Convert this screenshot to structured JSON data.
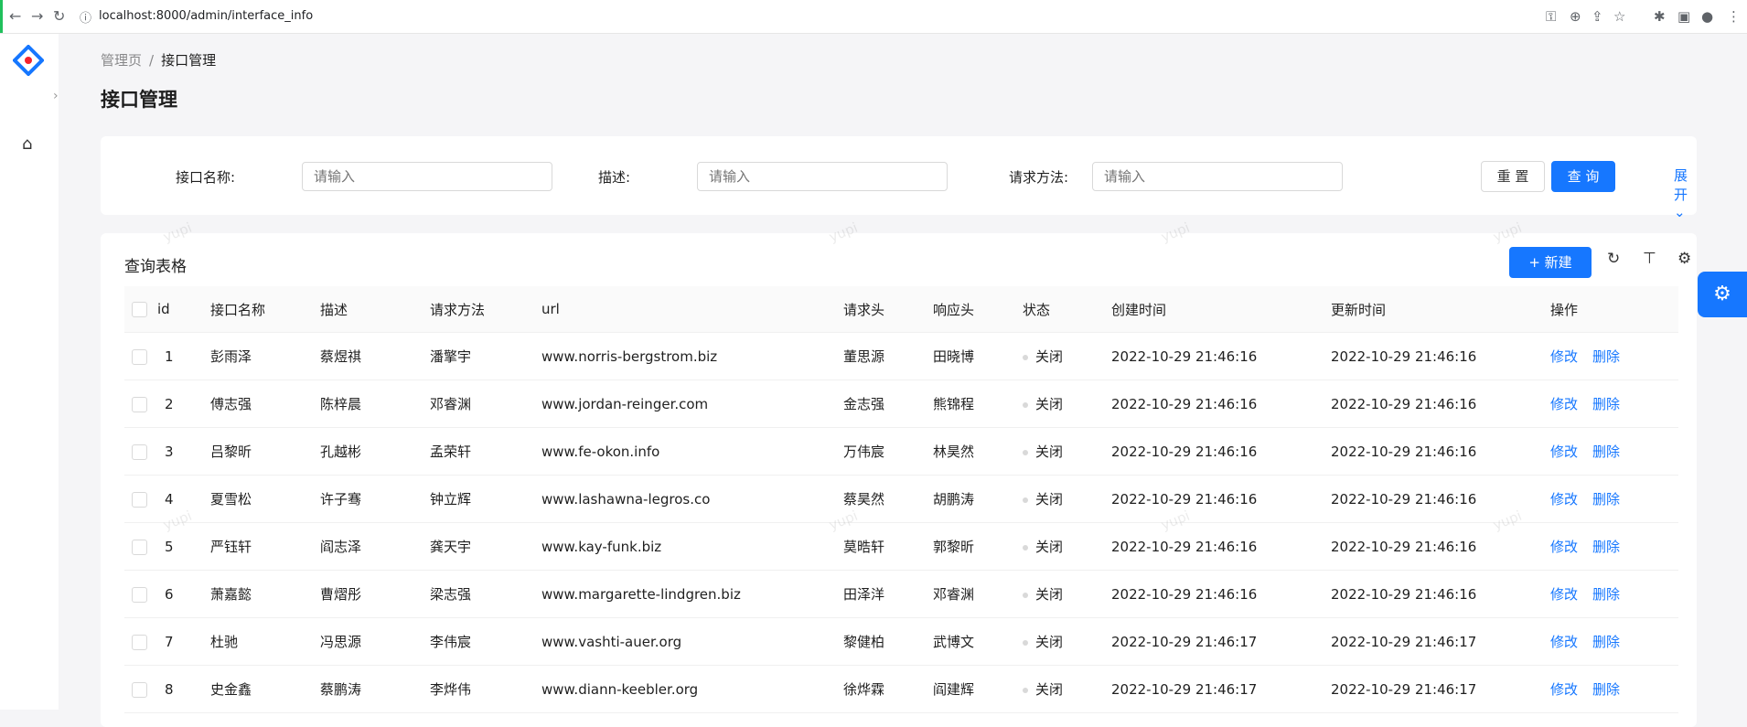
{
  "browser": {
    "url": "localhost:8000/admin/interface_info"
  },
  "breadcrumb": {
    "parent": "管理页",
    "separator": "/",
    "current": "接口管理"
  },
  "page_title": "接口管理",
  "search": {
    "fields": [
      {
        "label": "接口名称:",
        "placeholder": "请输入"
      },
      {
        "label": "描述:",
        "placeholder": "请输入"
      },
      {
        "label": "请求方法:",
        "placeholder": "请输入"
      }
    ],
    "reset_label": "重 置",
    "query_label": "查 询",
    "expand_label": "展开"
  },
  "table": {
    "title": "查询表格",
    "new_label": "+ 新建",
    "columns": [
      "id",
      "接口名称",
      "描述",
      "请求方法",
      "url",
      "请求头",
      "响应头",
      "状态",
      "创建时间",
      "更新时间",
      "操作"
    ],
    "edit_label": "修改",
    "delete_label": "删除",
    "rows": [
      {
        "id": "1",
        "name": "彭雨泽",
        "desc": "蔡煜祺",
        "method": "潘擎宇",
        "url": "www.norris-bergstrom.biz",
        "req": "董思源",
        "resp": "田晓博",
        "status": "关闭",
        "created": "2022-10-29 21:46:16",
        "updated": "2022-10-29 21:46:16"
      },
      {
        "id": "2",
        "name": "傅志强",
        "desc": "陈梓晨",
        "method": "邓睿渊",
        "url": "www.jordan-reinger.com",
        "req": "金志强",
        "resp": "熊锦程",
        "status": "关闭",
        "created": "2022-10-29 21:46:16",
        "updated": "2022-10-29 21:46:16"
      },
      {
        "id": "3",
        "name": "吕黎昕",
        "desc": "孔越彬",
        "method": "孟荣轩",
        "url": "www.fe-okon.info",
        "req": "万伟宸",
        "resp": "林昊然",
        "status": "关闭",
        "created": "2022-10-29 21:46:16",
        "updated": "2022-10-29 21:46:16"
      },
      {
        "id": "4",
        "name": "夏雪松",
        "desc": "许子骞",
        "method": "钟立辉",
        "url": "www.lashawna-legros.co",
        "req": "蔡昊然",
        "resp": "胡鹏涛",
        "status": "关闭",
        "created": "2022-10-29 21:46:16",
        "updated": "2022-10-29 21:46:16"
      },
      {
        "id": "5",
        "name": "严钰轩",
        "desc": "阎志泽",
        "method": "龚天宇",
        "url": "www.kay-funk.biz",
        "req": "莫晧轩",
        "resp": "郭黎昕",
        "status": "关闭",
        "created": "2022-10-29 21:46:16",
        "updated": "2022-10-29 21:46:16"
      },
      {
        "id": "6",
        "name": "萧嘉懿",
        "desc": "曹熠彤",
        "method": "梁志强",
        "url": "www.margarette-lindgren.biz",
        "req": "田泽洋",
        "resp": "邓睿渊",
        "status": "关闭",
        "created": "2022-10-29 21:46:16",
        "updated": "2022-10-29 21:46:16"
      },
      {
        "id": "7",
        "name": "杜驰",
        "desc": "冯思源",
        "method": "李伟宸",
        "url": "www.vashti-auer.org",
        "req": "黎健柏",
        "resp": "武博文",
        "status": "关闭",
        "created": "2022-10-29 21:46:17",
        "updated": "2022-10-29 21:46:17"
      },
      {
        "id": "8",
        "name": "史金鑫",
        "desc": "蔡鹏涛",
        "method": "李烨伟",
        "url": "www.diann-keebler.org",
        "req": "徐烨霖",
        "resp": "阎建辉",
        "status": "关闭",
        "created": "2022-10-29 21:46:17",
        "updated": "2022-10-29 21:46:17"
      }
    ]
  },
  "watermark": "yupi",
  "colors": {
    "primary": "#1677ff",
    "status_dot": "#d9d9d9"
  },
  "icons": [
    "back-icon",
    "forward-icon",
    "reload-icon",
    "key-icon",
    "zoom-icon",
    "share-icon",
    "star-icon",
    "extensions-icon",
    "sidepanel-icon",
    "profile-icon",
    "menu-icon",
    "logo-icon",
    "home-icon",
    "chevron-down-icon",
    "reload-table-icon",
    "density-icon",
    "settings-icon",
    "float-settings-icon"
  ]
}
